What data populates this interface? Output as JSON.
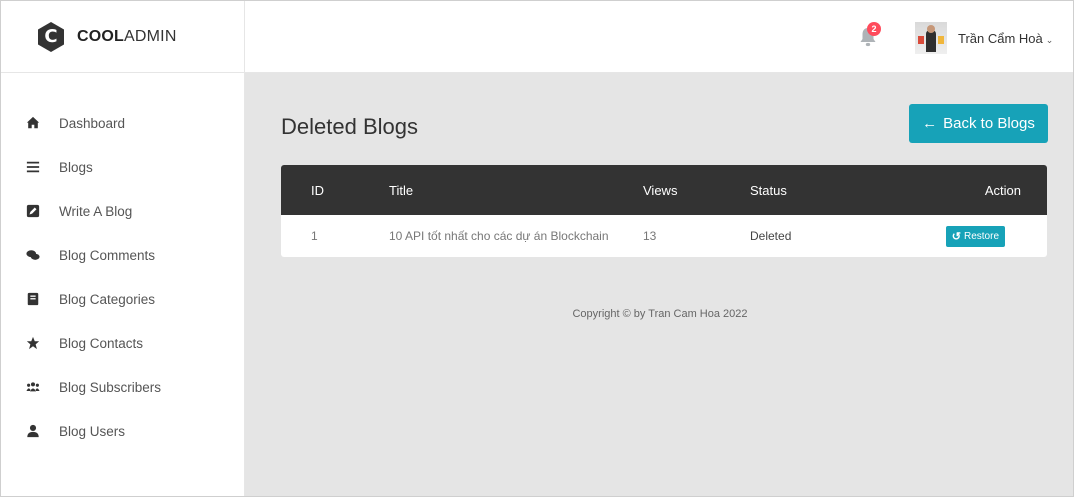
{
  "brand": {
    "logo_letter": "C",
    "name_bold": "COOL",
    "name_rest": "ADMIN"
  },
  "sidebar": {
    "items": [
      {
        "label": "Dashboard",
        "icon": "home-icon"
      },
      {
        "label": "Blogs",
        "icon": "list-icon"
      },
      {
        "label": "Write A Blog",
        "icon": "edit-icon"
      },
      {
        "label": "Blog Comments",
        "icon": "comments-icon"
      },
      {
        "label": "Blog Categories",
        "icon": "book-icon"
      },
      {
        "label": "Blog Contacts",
        "icon": "star-icon"
      },
      {
        "label": "Blog Subscribers",
        "icon": "users-icon"
      },
      {
        "label": "Blog Users",
        "icon": "user-icon"
      }
    ]
  },
  "header": {
    "notifications_count": "2",
    "user_name": "Trần Cẩm Hoà",
    "caret": "⌄"
  },
  "main": {
    "title": "Deleted Blogs",
    "back_button": {
      "arrow": "←",
      "label": "Back to Blogs"
    },
    "table": {
      "headers": {
        "id": "ID",
        "title": "Title",
        "views": "Views",
        "status": "Status",
        "action": "Action"
      },
      "rows": [
        {
          "id": "1",
          "title": "10 API tốt nhất cho các dự án Blockchain",
          "views": "13",
          "status": "Deleted",
          "action_label": "Restore"
        }
      ]
    },
    "copyright": "Copyright © by Tran Cam Hoa 2022"
  },
  "colors": {
    "accent": "#17a2b8",
    "table_header": "#333333",
    "badge": "#ff4b5c",
    "background": "#e5e5e5"
  }
}
